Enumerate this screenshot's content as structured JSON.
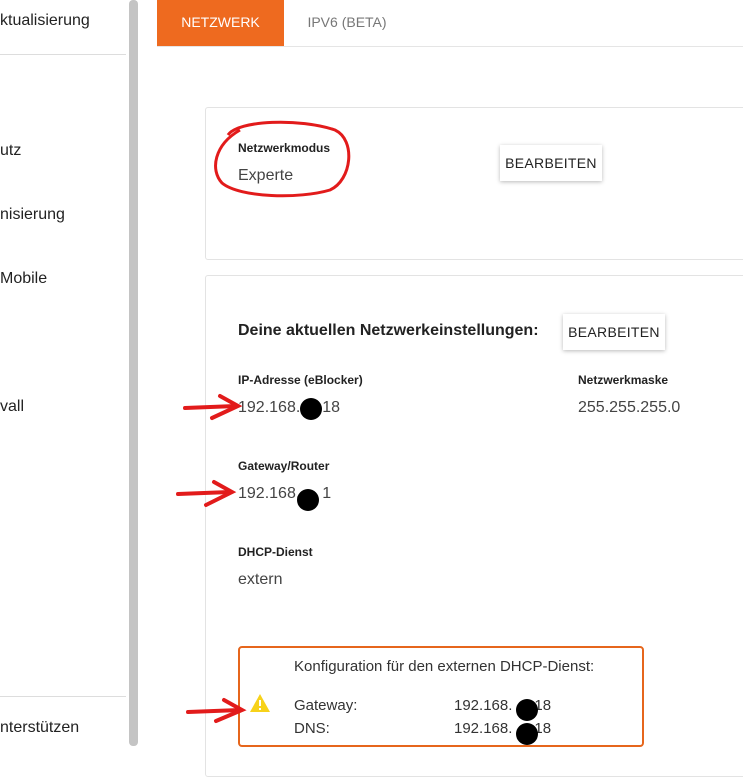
{
  "sidebar": {
    "items": [
      {
        "label": "ktualisierung"
      },
      {
        "label": "utz"
      },
      {
        "label": "nisierung"
      },
      {
        "label": "Mobile"
      },
      {
        "label": "vall"
      },
      {
        "label": "nterstützen"
      }
    ]
  },
  "tabs": [
    {
      "label": "NETZWERK",
      "active": true
    },
    {
      "label": "IPV6 (BETA)",
      "active": false
    }
  ],
  "mode_card": {
    "label": "Netzwerkmodus",
    "value": "Experte",
    "edit_label": "BEARBEITEN"
  },
  "settings_card": {
    "title": "Deine aktuellen Netzwerkeinstellungen:",
    "edit_label": "BEARBEITEN",
    "ip_label": "IP-Adresse (eBlocker)",
    "ip_prefix": "192.168.",
    "ip_suffix": "18",
    "netmask_label": "Netzwerkmaske",
    "netmask_value": "255.255.255.0",
    "gateway_label": "Gateway/Router",
    "gateway_prefix": "192.168.",
    "gateway_suffix": "1",
    "dhcp_label": "DHCP-Dienst",
    "dhcp_value": "extern"
  },
  "dhcp_warning": {
    "title": "Konfiguration für den externen DHCP-Dienst:",
    "gateway_label": "Gateway:",
    "gateway_prefix": "192.168.",
    "gateway_suffix": "18",
    "dns_label": "DNS:",
    "dns_prefix": "192.168.",
    "dns_suffix": "18",
    "icon": "warning-triangle-icon"
  },
  "colors": {
    "accent": "#ee6a1f",
    "annotation": "#e21b1b",
    "warning_icon": "#f7d21a"
  }
}
